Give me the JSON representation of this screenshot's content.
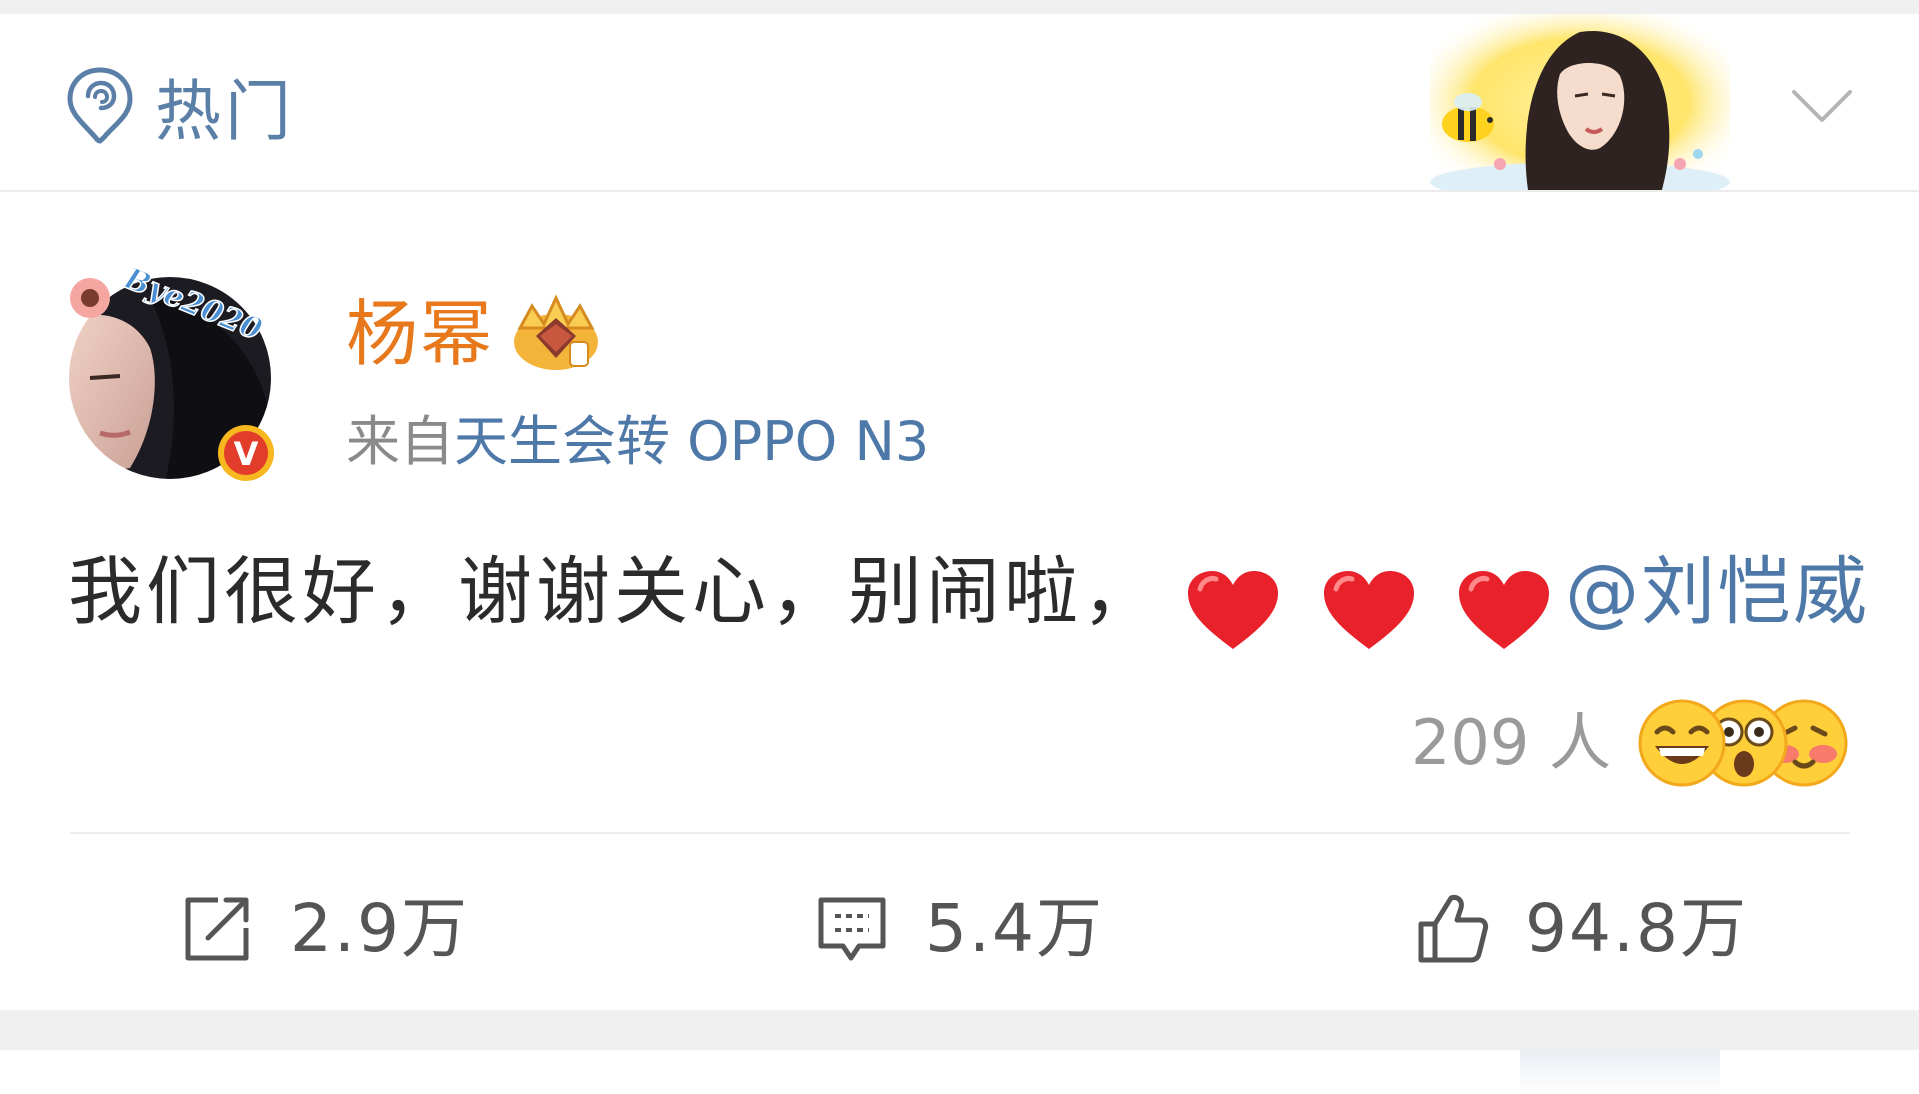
{
  "header": {
    "tab_label": "热门",
    "icons": {
      "tab_icon": "hot-topic-icon",
      "banner": "celebrity-cartoon-banner",
      "chevron": "chevron-down-icon"
    },
    "accent_color": "#5b7fa6"
  },
  "post": {
    "username": "杨幂",
    "username_color": "#e8781c",
    "avatar_badge": "Bye2020",
    "verified_mark": "V",
    "source_prefix": "来自",
    "source_device": "天生会转 OPPO N3",
    "text": "我们很好，谢谢关心，别闹啦，",
    "hearts": 3,
    "mention": "@刘恺威",
    "reaction_count": "209 人",
    "reaction_icons": [
      "laughing-emoji-icon",
      "shocked-emoji-icon",
      "blush-emoji-icon"
    ]
  },
  "actions": {
    "repost": {
      "icon": "share-icon",
      "count": "2.9万"
    },
    "comment": {
      "icon": "comment-icon",
      "count": "5.4万"
    },
    "like": {
      "icon": "thumbs-up-icon",
      "count": "94.8万"
    }
  },
  "colors": {
    "link": "#4d78a8",
    "heart": "#e8212b",
    "muted": "#8a8a8a"
  }
}
